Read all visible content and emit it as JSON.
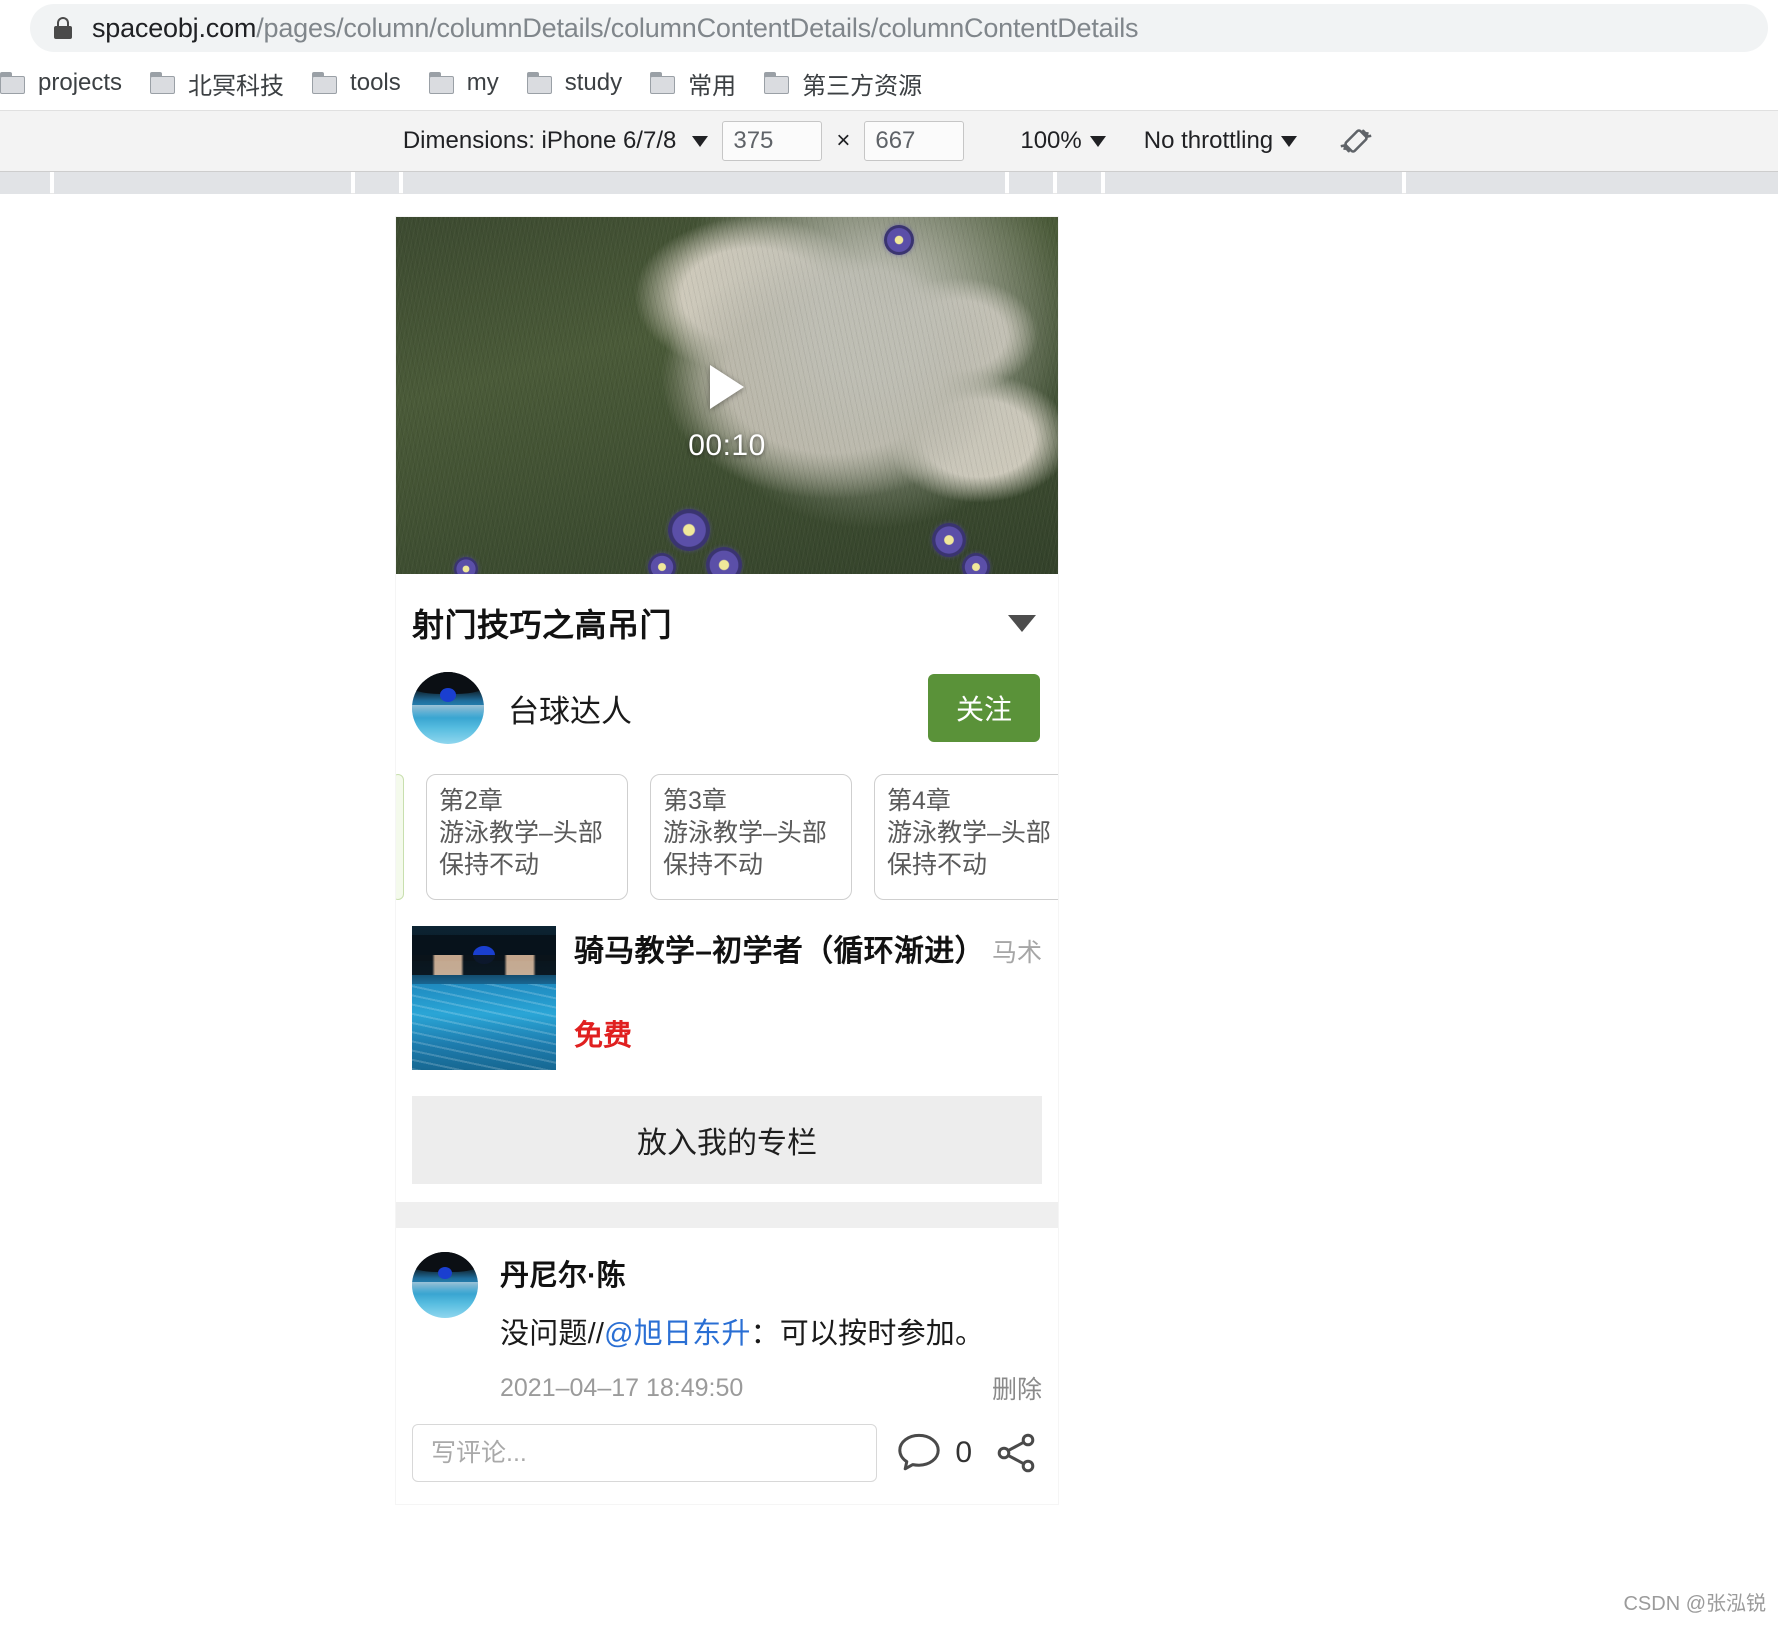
{
  "browser": {
    "omnibox": {
      "host": "spaceobj.com",
      "path": "/pages/column/columnDetails/columnContentDetails/columnContentDetails",
      "lock_icon": "lock-icon"
    },
    "bookmarks": [
      {
        "label": "projects",
        "icon": "folder-icon"
      },
      {
        "label": "北冥科技",
        "icon": "folder-icon"
      },
      {
        "label": "tools",
        "icon": "folder-icon"
      },
      {
        "label": "my",
        "icon": "folder-icon"
      },
      {
        "label": "study",
        "icon": "folder-icon"
      },
      {
        "label": "常用",
        "icon": "folder-icon"
      },
      {
        "label": "第三方资源",
        "icon": "folder-icon"
      }
    ]
  },
  "devtools": {
    "dimensions_label": "Dimensions: iPhone 6/7/8",
    "width": "375",
    "height": "667",
    "multiply": "×",
    "zoom": "100%",
    "throttling": "No throttling",
    "rotate_icon": "rotate-device-icon"
  },
  "page": {
    "video": {
      "duration": "00:10",
      "play_icon": "play-icon"
    },
    "title": "射门技巧之高吊门",
    "expand_icon": "chevron-down-icon",
    "author": {
      "name": "台球达人",
      "follow_label": "关注",
      "follow_color": "#5a9239",
      "avatar": "avatar"
    },
    "chapters": [
      {
        "no": "",
        "title": "",
        "partial": true
      },
      {
        "no": "第2章",
        "title": "游泳教学–头部保持不动"
      },
      {
        "no": "第3章",
        "title": "游泳教学–头部保持不动"
      },
      {
        "no": "第4章",
        "title": "游泳教学–头部保持不动"
      }
    ],
    "course": {
      "title": "骑马教学–初学者（循环渐进）",
      "tag": "马术",
      "price": "免费",
      "price_color": "#e02020",
      "thumb": "course-thumbnail"
    },
    "add_column_label": "放入我的专栏",
    "comment": {
      "author": "丹尼尔·陈",
      "text_prefix": "没问题//",
      "mention": "@旭日东升",
      "text_suffix": "：可以按时参加。",
      "time": "2021–04–17 18:49:50",
      "delete_label": "删除"
    },
    "footer": {
      "input_placeholder": "写评论...",
      "comment_icon": "comment-bubble-icon",
      "comment_count": "0",
      "share_icon": "share-icon"
    }
  },
  "watermark": "CSDN @张泓锐"
}
